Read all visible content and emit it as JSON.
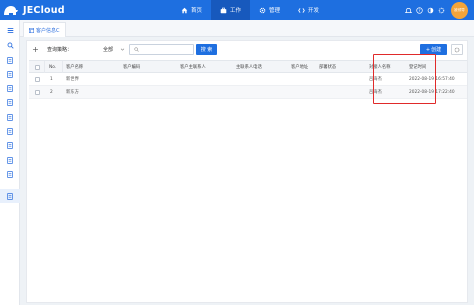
{
  "app": {
    "brand": "JECloud"
  },
  "topnav": [
    {
      "label": "首页",
      "icon": "home-icon"
    },
    {
      "label": "工作",
      "icon": "briefcase-icon",
      "active": true
    },
    {
      "label": "管理",
      "icon": "gear-icon"
    },
    {
      "label": "开发",
      "icon": "code-icon"
    }
  ],
  "user": {
    "avatar_text": "被领导"
  },
  "tab": {
    "label": "客户信息C"
  },
  "toolbar": {
    "query_label": "查询策略：",
    "query_value": "全部",
    "search_placeholder": "",
    "search_button": "搜 索",
    "create_button": "创建"
  },
  "table": {
    "columns": [
      "No.",
      "客户名称",
      "客户编码",
      "客户主联系人",
      "主联系人电话",
      "客户地址",
      "部署状态",
      "对接人名称",
      "登记时间"
    ],
    "rows": [
      {
        "no": "1",
        "name": "新世界",
        "code": "",
        "contact": "",
        "phone": "",
        "address": "",
        "status": "",
        "owner": "吕海杰",
        "time": "2022-08-19 16:57:40"
      },
      {
        "no": "2",
        "name": "新东方",
        "code": "",
        "contact": "",
        "phone": "",
        "address": "",
        "status": "",
        "owner": "吕海杰",
        "time": "2022-08-19 17:22:40"
      }
    ]
  },
  "colors": {
    "primary": "#1e6fe0",
    "highlight": "#e02a2a"
  }
}
